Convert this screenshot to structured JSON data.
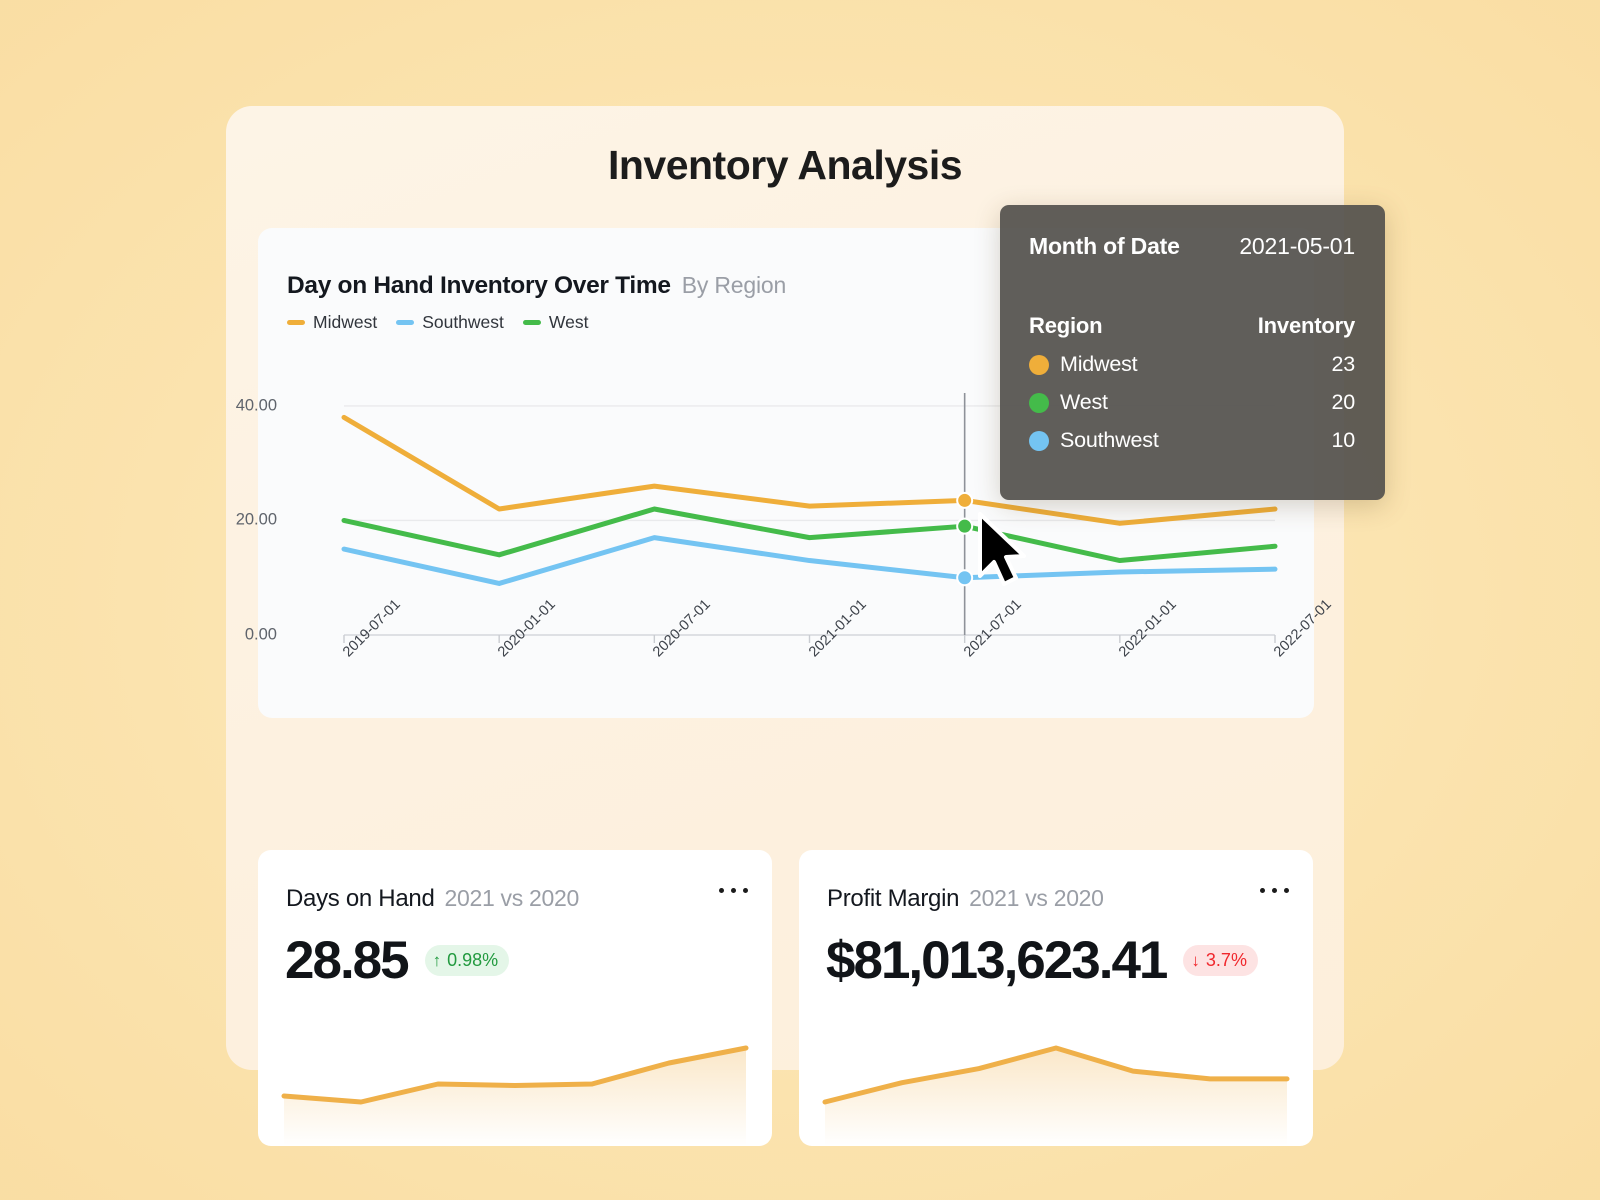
{
  "page": {
    "title": "Inventory Analysis",
    "background_color": "#fbe3ae",
    "panel_color": "#fdf2e2"
  },
  "chart_card": {
    "title": "Day on Hand Inventory Over Time",
    "subtitle": "By Region",
    "legend": [
      {
        "label": "Midwest",
        "color": "#efae3a"
      },
      {
        "label": "Southwest",
        "color": "#74c4f2"
      },
      {
        "label": "West",
        "color": "#44bb4a"
      }
    ]
  },
  "chart_data": {
    "type": "line",
    "title": "Day on Hand Inventory Over Time",
    "subtitle": "By Region",
    "xlabel": "",
    "ylabel": "",
    "x": [
      "2019-07-01",
      "2020-01-01",
      "2020-07-01",
      "2021-01-01",
      "2021-07-01",
      "2022-01-01",
      "2022-07-01"
    ],
    "tick_labels": [
      "2019-07-01",
      "2020-01-01",
      "2020-07-01",
      "2021-01-01",
      "2021-07-01",
      "2022-01-01",
      "2022-07-01"
    ],
    "ytick_labels": [
      "0.00",
      "20.00",
      "40.00"
    ],
    "yticks": [
      0,
      20,
      40
    ],
    "ylim": [
      0,
      44
    ],
    "grid": true,
    "legend_position": "top-left",
    "series": [
      {
        "name": "Midwest",
        "color": "#efae3a",
        "values": [
          38.0,
          22.0,
          26.0,
          22.5,
          23.5,
          19.5,
          22.0
        ]
      },
      {
        "name": "Southwest",
        "color": "#74c4f2",
        "values": [
          15.0,
          9.0,
          17.0,
          13.0,
          10.0,
          11.0,
          11.5
        ]
      },
      {
        "name": "West",
        "color": "#44bb4a",
        "values": [
          20.0,
          14.0,
          22.0,
          17.0,
          19.0,
          13.0,
          15.5
        ]
      }
    ],
    "highlight": {
      "x_index": 4,
      "points": [
        {
          "name": "Midwest",
          "value": 23.5,
          "color": "#efae3a"
        },
        {
          "name": "West",
          "value": 19.0,
          "color": "#44bb4a"
        },
        {
          "name": "Southwest",
          "value": 10.0,
          "color": "#74c4f2"
        }
      ]
    }
  },
  "tooltip": {
    "date_key": "Month of Date",
    "date_value": "2021-05-01",
    "col_region": "Region",
    "col_inventory": "Inventory",
    "rows": [
      {
        "region": "Midwest",
        "value": "23",
        "color": "#efae3a"
      },
      {
        "region": "West",
        "value": "20",
        "color": "#44bb4a"
      },
      {
        "region": "Southwest",
        "value": "10",
        "color": "#74c4f2"
      }
    ]
  },
  "kpi_cards": [
    {
      "title": "Days on Hand",
      "period": "2021 vs 2020",
      "value": "28.85",
      "delta": "0.98%",
      "delta_direction": "up",
      "delta_arrow": "↑",
      "delta_color": "#229a3f",
      "spark_values": [
        30,
        26,
        38,
        37,
        38,
        52,
        62
      ],
      "spark_color": "#efb049"
    },
    {
      "title": "Profit Margin",
      "period": "2021 vs 2020",
      "value": "$81,013,623.41",
      "delta": "3.7%",
      "delta_direction": "down",
      "delta_arrow": "↓",
      "delta_color": "#f0282d",
      "spark_values": [
        30,
        45,
        56,
        72,
        54,
        48,
        48
      ],
      "spark_color": "#efb049"
    }
  ]
}
